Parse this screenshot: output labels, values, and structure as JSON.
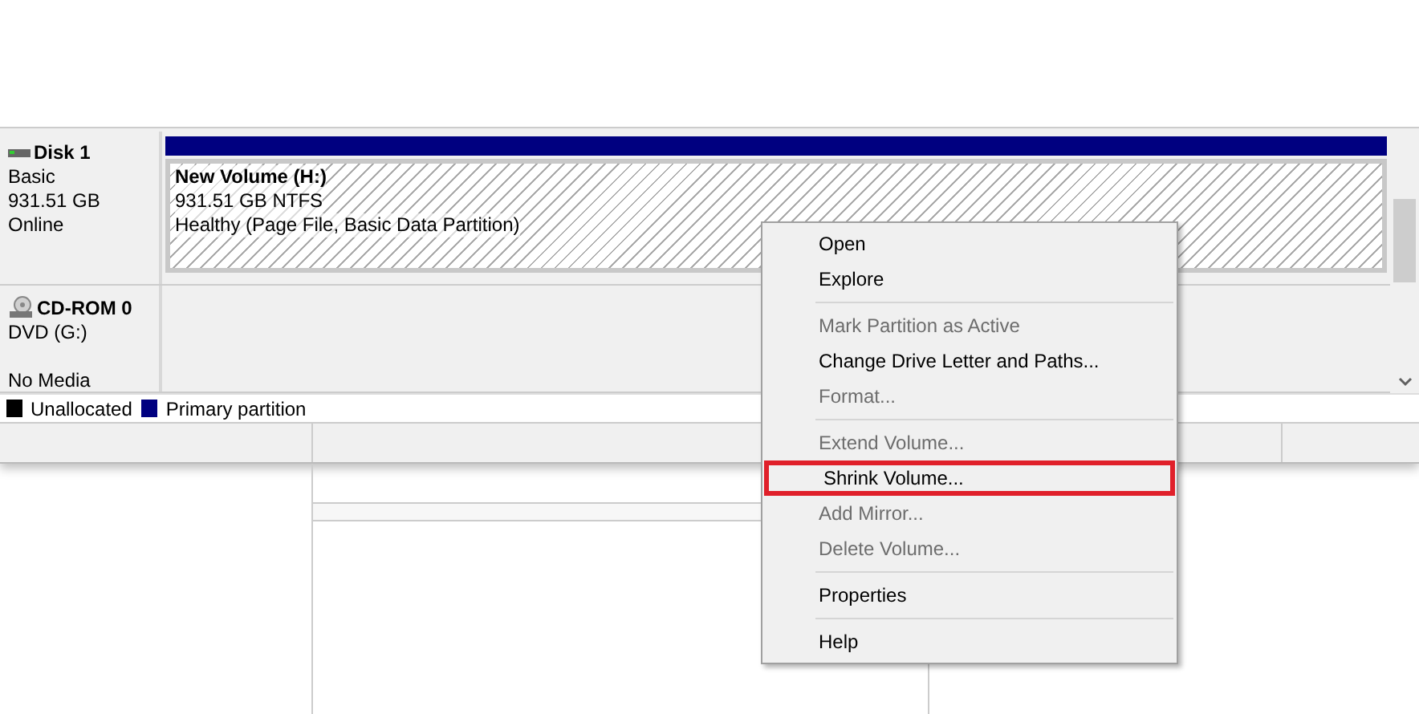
{
  "disks": [
    {
      "name": "Disk 1",
      "kind": "disk",
      "lines": [
        "Basic",
        "931.51 GB",
        "Online"
      ],
      "partition": {
        "title": "New Volume  (H:)",
        "lines": [
          "931.51 GB NTFS",
          "Healthy (Page File, Basic Data Partition)"
        ],
        "color": "#000080"
      }
    },
    {
      "name": "CD-ROM 0",
      "kind": "cdrom",
      "lines": [
        "DVD (G:)"
      ],
      "media_status": "No Media"
    }
  ],
  "legend": [
    {
      "label": "Unallocated",
      "color": "#000000"
    },
    {
      "label": "Primary partition",
      "color": "#000080"
    }
  ],
  "context_menu": [
    {
      "kind": "item",
      "label": "Open",
      "disabled": false,
      "outlined": false
    },
    {
      "kind": "item",
      "label": "Explore",
      "disabled": false,
      "outlined": false
    },
    {
      "kind": "separator"
    },
    {
      "kind": "item",
      "label": "Mark Partition as Active",
      "disabled": true,
      "outlined": false
    },
    {
      "kind": "item",
      "label": "Change Drive Letter and Paths...",
      "disabled": false,
      "outlined": false
    },
    {
      "kind": "item",
      "label": "Format...",
      "disabled": true,
      "outlined": false
    },
    {
      "kind": "separator"
    },
    {
      "kind": "item",
      "label": "Extend Volume...",
      "disabled": true,
      "outlined": false
    },
    {
      "kind": "item",
      "label": "Shrink Volume...",
      "disabled": false,
      "outlined": true
    },
    {
      "kind": "item",
      "label": "Add Mirror...",
      "disabled": true,
      "outlined": false
    },
    {
      "kind": "item",
      "label": "Delete Volume...",
      "disabled": true,
      "outlined": false
    },
    {
      "kind": "separator"
    },
    {
      "kind": "item",
      "label": "Properties",
      "disabled": false,
      "outlined": false
    },
    {
      "kind": "separator"
    },
    {
      "kind": "item",
      "label": "Help",
      "disabled": false,
      "outlined": false
    }
  ]
}
